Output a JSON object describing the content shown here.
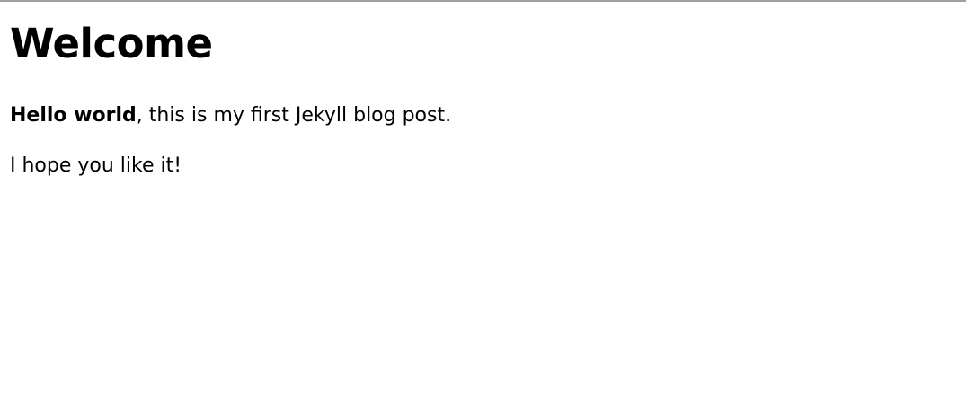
{
  "page": {
    "title": "Welcome",
    "paragraphs": [
      {
        "bold": "Hello world",
        "rest": ", this is my first Jekyll blog post."
      },
      {
        "text": "I hope you like it!"
      }
    ]
  },
  "colors": {
    "background": "#ffffff",
    "text": "#000000",
    "top_rule": "#a0a0a0"
  }
}
